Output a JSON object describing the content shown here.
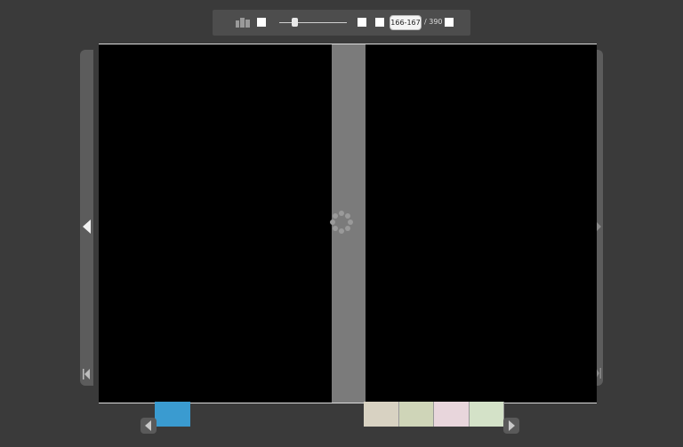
{
  "toolbar": {
    "icons": [
      "books-icon",
      "square-icon",
      "zoom-slider",
      "square-icon",
      "square-icon",
      "square-icon"
    ],
    "zoom_level": 0.2,
    "page_field_value": "166-167",
    "page_total": "/ 390"
  },
  "colors": {
    "background": "#3a3a3a",
    "toolbar": "#4d4d4d",
    "page": "#000000",
    "spine": "#7b7b7b",
    "side_panel": "#5c5c5c",
    "thumb_accent": "#3a9bd0"
  },
  "thumbnails": {
    "left_count": 1,
    "right_count": 4
  }
}
